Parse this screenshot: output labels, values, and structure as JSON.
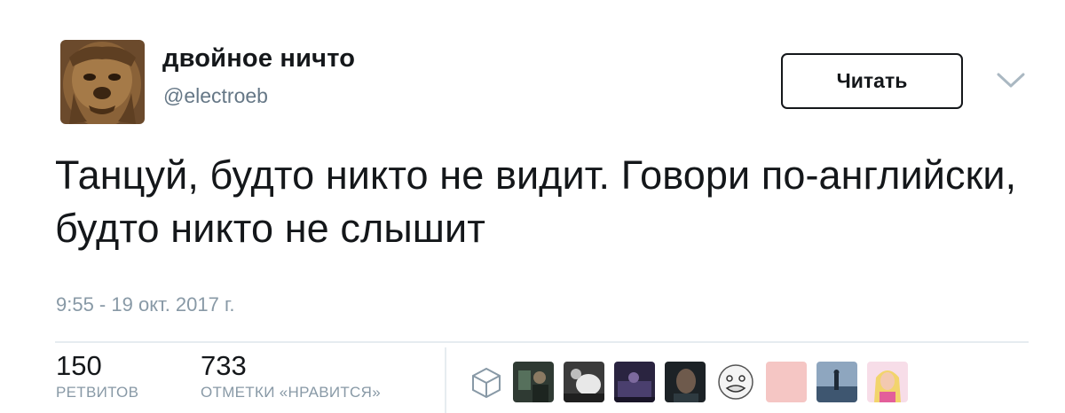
{
  "user": {
    "display_name": "двойное ничто",
    "handle": "@electroeb",
    "avatar_icon": "chewbacca-avatar"
  },
  "follow_button": {
    "label": "Читать"
  },
  "menu_icon": "chevron-down-icon",
  "tweet": {
    "text": "Танцуй, будто никто не видит. Говори по-английски, будто никто не слышит",
    "timestamp": "9:55 - 19 окт. 2017 г."
  },
  "stats": {
    "retweets": {
      "count": "150",
      "label": "РЕТВИТОВ"
    },
    "likes": {
      "count": "733",
      "label": "ОТМЕТКИ «НРАВИТСЯ»"
    }
  },
  "likers": [
    {
      "name": "liker-avatar-default-egg"
    },
    {
      "name": "liker-avatar-photo-dark-green"
    },
    {
      "name": "liker-avatar-photo-bw"
    },
    {
      "name": "liker-avatar-photo-purple"
    },
    {
      "name": "liker-avatar-photo-face-dark"
    },
    {
      "name": "liker-avatar-meme-face"
    },
    {
      "name": "liker-avatar-pink"
    },
    {
      "name": "liker-avatar-photo-blue"
    },
    {
      "name": "liker-avatar-doll"
    }
  ]
}
